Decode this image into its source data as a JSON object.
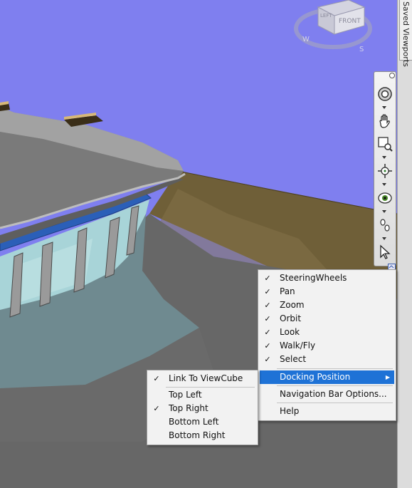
{
  "side_panel": {
    "tab_label": "Saved Viewports"
  },
  "viewcube": {
    "face_label": "FRONT",
    "side_label": "LEFT",
    "compass_w": "W",
    "compass_s": "S"
  },
  "navigation_bar": {
    "tools": [
      {
        "icon": "steering-wheel-icon"
      },
      {
        "icon": "pan-hand-icon"
      },
      {
        "icon": "zoom-window-icon"
      },
      {
        "icon": "orbit-icon"
      },
      {
        "icon": "look-eye-icon"
      },
      {
        "icon": "walk-footprints-icon"
      },
      {
        "icon": "select-arrow-icon"
      }
    ]
  },
  "context_menu": {
    "items": [
      {
        "label": "SteeringWheels",
        "checked": true
      },
      {
        "label": "Pan",
        "checked": true
      },
      {
        "label": "Zoom",
        "checked": true
      },
      {
        "label": "Orbit",
        "checked": true
      },
      {
        "label": "Look",
        "checked": true
      },
      {
        "label": "Walk/Fly",
        "checked": true
      },
      {
        "label": "Select",
        "checked": true
      },
      {
        "label": "Docking Position",
        "highlighted": true,
        "submenu": true
      },
      {
        "label": "Navigation Bar Options..."
      },
      {
        "label": "Help"
      }
    ],
    "check_mark": "✓",
    "submenu_arrow": "▶"
  },
  "docking_submenu": {
    "items": [
      {
        "label": "Link To ViewCube",
        "checked": true
      },
      {
        "label": "Top Left",
        "checked": false
      },
      {
        "label": "Top Right",
        "checked": true
      },
      {
        "label": "Bottom Left",
        "checked": false
      },
      {
        "label": "Bottom Right",
        "checked": false
      }
    ]
  },
  "colors": {
    "sky": "#7f7fef",
    "ground": "#676767",
    "terrain": "#6f5f38",
    "highlight": "#1e72d6"
  }
}
